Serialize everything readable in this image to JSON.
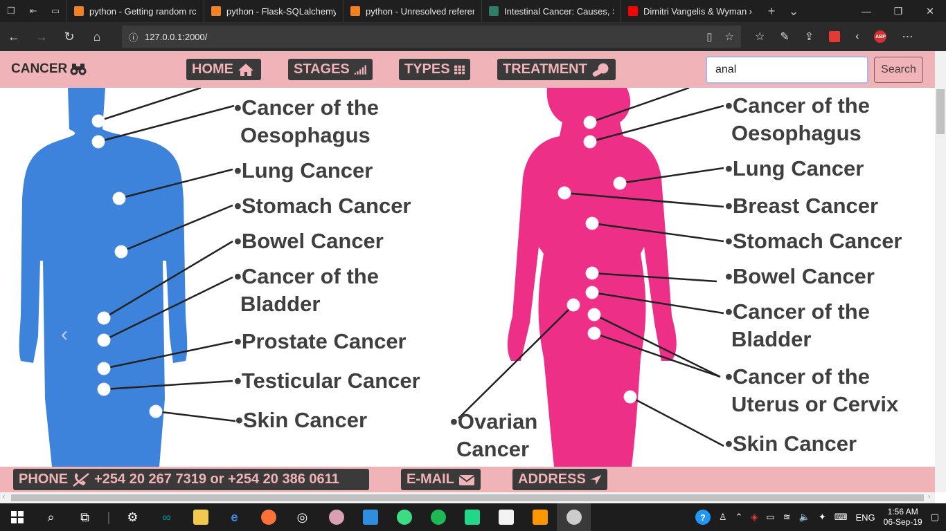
{
  "browser": {
    "tabs": [
      {
        "label": "python - Getting random rc",
        "icon": "stackoverflow-icon",
        "color": "#f48024"
      },
      {
        "label": "python - Flask-SQLalchemy",
        "icon": "stackoverflow-icon",
        "color": "#f48024"
      },
      {
        "label": "python - Unresolved referer",
        "icon": "stackoverflow-icon",
        "color": "#f48024"
      },
      {
        "label": "Intestinal Cancer: Causes, Sy",
        "icon": "site-icon",
        "color": "#2e7d6b"
      },
      {
        "label": "Dimitri Vangelis & Wyman ›",
        "icon": "youtube-icon",
        "color": "#ff0000"
      }
    ],
    "url": "127.0.0.1:2000/"
  },
  "site": {
    "brand": "CANCER",
    "nav": {
      "home": "HOME",
      "stages": "STAGES",
      "types": "TYPES",
      "treatment": "TREATMENT"
    },
    "search": {
      "value": "anal",
      "button": "Search"
    },
    "slide": {
      "male_labels": [
        "•Cancer of the",
        "Oesophagus",
        "•Lung Cancer",
        "•Stomach Cancer",
        "•Bowel Cancer",
        "•Cancer of the",
        "Bladder",
        "•Prostate Cancer",
        "•Testicular Cancer",
        "•Skin Cancer"
      ],
      "female_labels": [
        "•Cancer of the",
        "Oesophagus",
        "•Lung Cancer",
        "•Breast Cancer",
        "•Stomach Cancer",
        "•Bowel Cancer",
        "•Cancer of the",
        "Bladder",
        "•Cancer of the",
        "Uterus or Cervix",
        "•Skin Cancer",
        "•Ovarian",
        "Cancer"
      ],
      "colors": {
        "male": "#3d83dc",
        "female": "#ed2f87"
      }
    },
    "footer": {
      "phone_label": "PHONE",
      "phone_numbers": "+254 20 267 7319 or +254 20 386 0611",
      "email_label": "E-MAIL",
      "address_label": "ADDRESS"
    },
    "colors": {
      "navbar": "#f0b3b8",
      "button_bg": "#3a3a3a",
      "button_text": "#f0b3b8"
    }
  },
  "taskbar": {
    "language": "ENG",
    "time": "1:56 AM",
    "date": "06-Sep-19"
  }
}
